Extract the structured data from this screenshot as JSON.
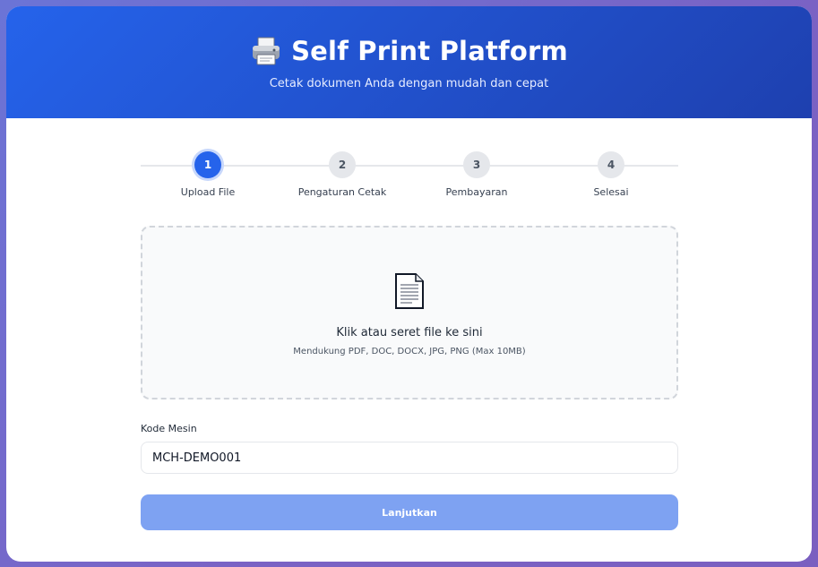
{
  "header": {
    "title": "Self Print Platform",
    "subtitle": "Cetak dokumen Anda dengan mudah dan cepat",
    "icon": "printer-icon"
  },
  "steps": [
    {
      "number": "1",
      "label": "Upload File",
      "active": true
    },
    {
      "number": "2",
      "label": "Pengaturan Cetak",
      "active": false
    },
    {
      "number": "3",
      "label": "Pembayaran",
      "active": false
    },
    {
      "number": "4",
      "label": "Selesai",
      "active": false
    }
  ],
  "upload": {
    "icon": "document-icon",
    "title": "Klik atau seret file ke sini",
    "subtitle": "Mendukung PDF, DOC, DOCX, JPG, PNG (Max 10MB)"
  },
  "machine": {
    "label": "Kode Mesin",
    "value": "MCH-DEMO001"
  },
  "actions": {
    "continue_label": "Lanjutkan"
  },
  "colors": {
    "primary": "#2563eb",
    "header_dark": "#1e40af",
    "button_disabled": "#7ea2f2",
    "background": "#7068cc"
  }
}
